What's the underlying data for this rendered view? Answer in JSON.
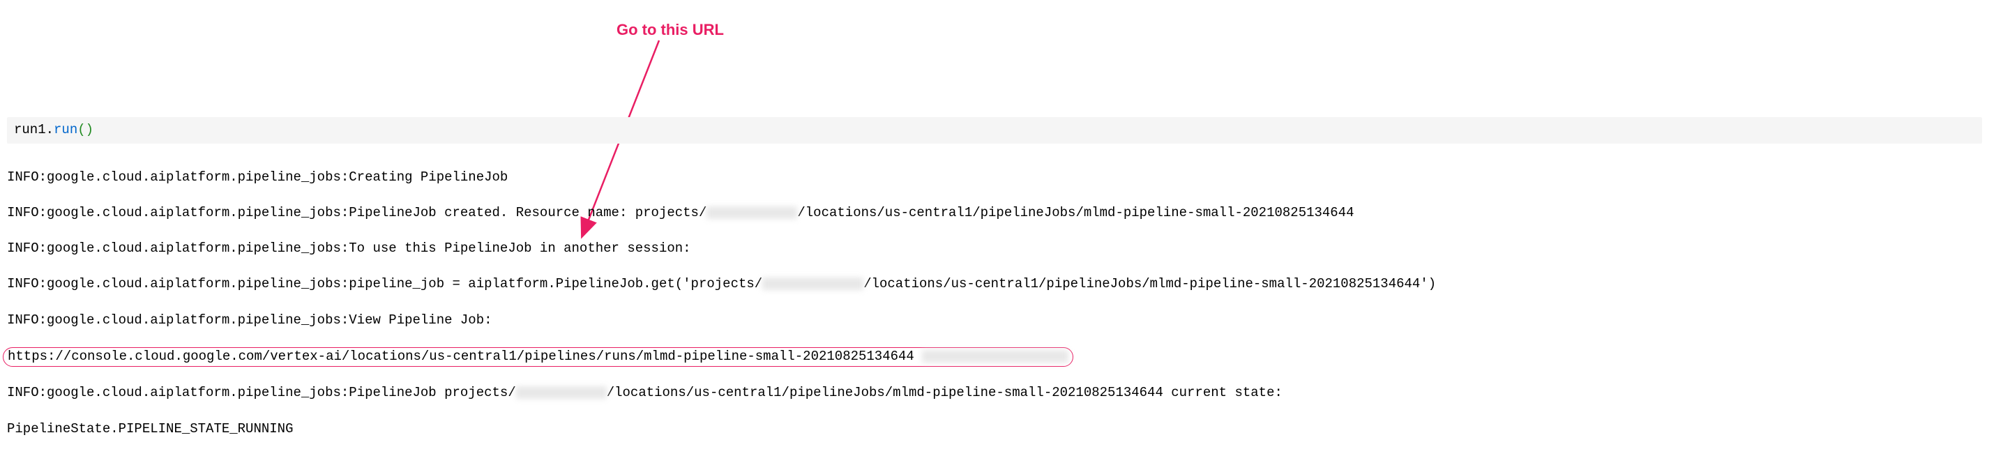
{
  "annotation": {
    "label": "Go to this URL"
  },
  "code": {
    "object": "run1",
    "dot": ".",
    "method": "run",
    "parens": "()"
  },
  "output": {
    "line1_prefix": "INFO:google.cloud.aiplatform.pipeline_jobs:Creating PipelineJob",
    "line2_prefix": "INFO:google.cloud.aiplatform.pipeline_jobs:PipelineJob created. Resource name: projects/",
    "line2_suffix": "/locations/us-central1/pipelineJobs/mlmd-pipeline-small-20210825134644",
    "line3": "INFO:google.cloud.aiplatform.pipeline_jobs:To use this PipelineJob in another session:",
    "line4_prefix": "INFO:google.cloud.aiplatform.pipeline_jobs:pipeline_job = aiplatform.PipelineJob.get('projects/",
    "line4_suffix": "/locations/us-central1/pipelineJobs/mlmd-pipeline-small-20210825134644')",
    "line5": "INFO:google.cloud.aiplatform.pipeline_jobs:View Pipeline Job:",
    "line6_url": "https://console.cloud.google.com/vertex-ai/locations/us-central1/pipelines/runs/mlmd-pipeline-small-20210825134644",
    "line7_prefix": "INFO:google.cloud.aiplatform.pipeline_jobs:PipelineJob projects/",
    "line7_suffix": "/locations/us-central1/pipelineJobs/mlmd-pipeline-small-20210825134644 current state:",
    "line8": "PipelineState.PIPELINE_STATE_RUNNING"
  }
}
